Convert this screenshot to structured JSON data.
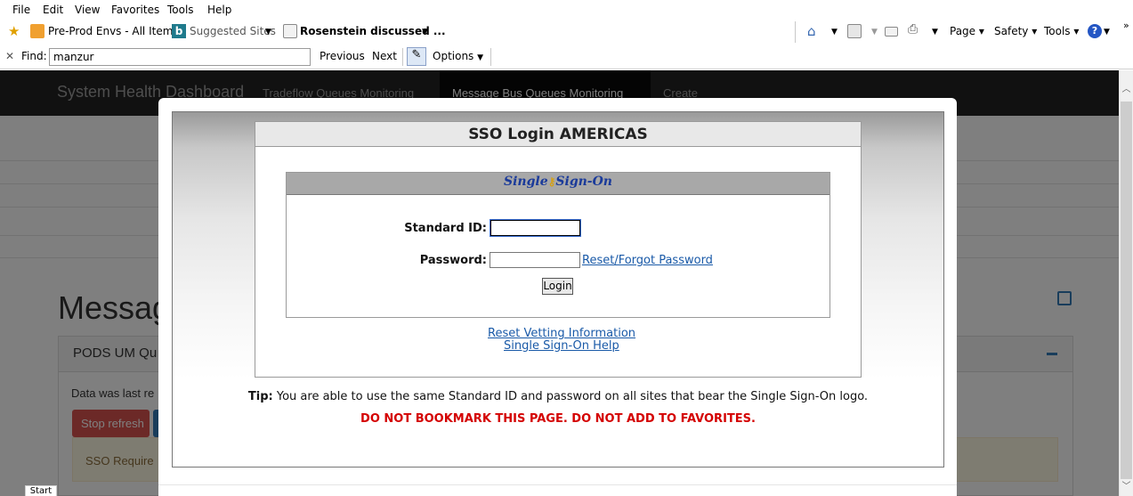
{
  "menu": [
    "File",
    "Edit",
    "View",
    "Favorites",
    "Tools",
    "Help"
  ],
  "favorites": {
    "prod_envs": "Pre-Prod Envs - All Items",
    "suggested": "Suggested Sites",
    "article": "Rosenstein discussed ..."
  },
  "toolbar": {
    "page": "Page",
    "safety": "Safety",
    "tools": "Tools"
  },
  "findbar": {
    "label": "Find:",
    "value": "manzur",
    "previous": "Previous",
    "next": "Next",
    "options": "Options"
  },
  "app": {
    "brand": "System Health Dashboard",
    "nav": [
      "Tradeflow Queues Monitoring",
      "Message Bus Queues Monitoring",
      "Create"
    ],
    "page_title": "Messag",
    "panel_title": "PODS UM Qu",
    "data_text": "Data was last re",
    "stop_refresh": "Stop refresh",
    "alert_text": "SSO Require",
    "start": "Start"
  },
  "sso": {
    "title": "SSO Login AMERICAS",
    "logo_left": "Single",
    "logo_right": "Sign-On",
    "standard_id_label": "Standard ID:",
    "standard_id_value": "",
    "password_label": "Password:",
    "password_value": "",
    "reset_forgot": "Reset/Forgot Password",
    "login_button": "Login",
    "reset_vetting": "Reset Vetting Information",
    "help": "Single Sign-On Help",
    "tip_label": "Tip:",
    "tip_text": " You are able to use the same Standard ID and password on all sites that bear the Single Sign-On logo.",
    "warning": "DO NOT BOOKMARK THIS PAGE. DO NOT ADD TO FAVORITES."
  }
}
